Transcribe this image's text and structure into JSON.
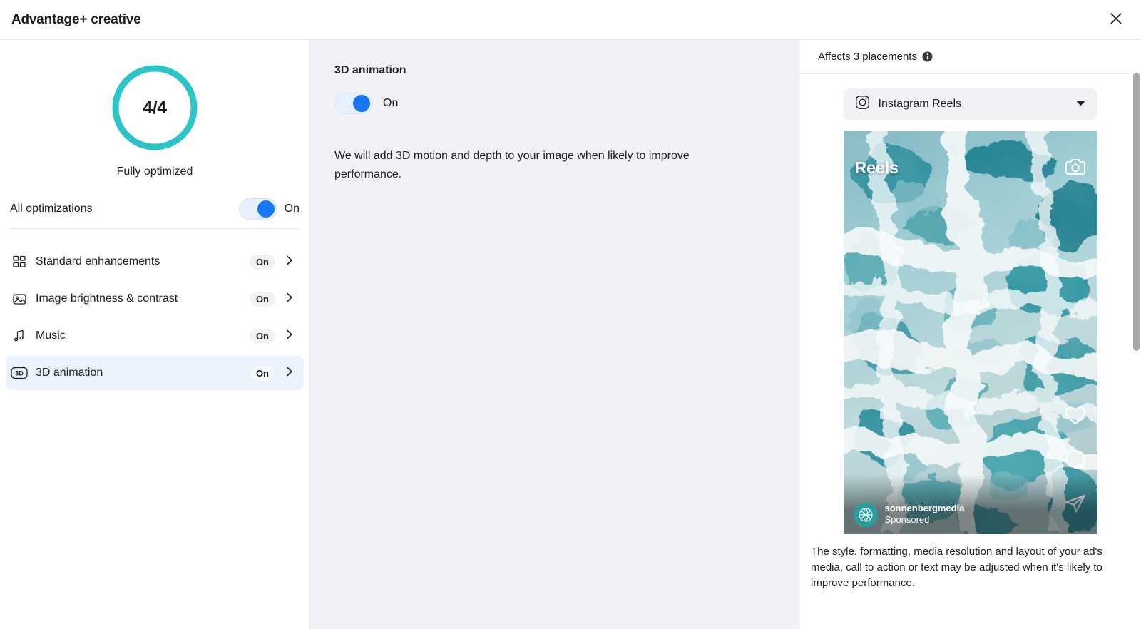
{
  "header": {
    "title": "Advantage+ creative",
    "close_icon": "close-icon"
  },
  "sidebar": {
    "gauge": {
      "value": "4/4",
      "label": "Fully optimized",
      "ring_color": "#2CC5C5",
      "completed": 4,
      "total": 4
    },
    "all_optimizations": {
      "label": "All optimizations",
      "state": "On"
    },
    "items": [
      {
        "icon": "grid-icon",
        "label": "Standard enhancements",
        "badge": "On",
        "selected": false
      },
      {
        "icon": "image-icon",
        "label": "Image brightness & contrast",
        "badge": "On",
        "selected": false
      },
      {
        "icon": "music-note-icon",
        "label": "Music",
        "badge": "On",
        "selected": false
      },
      {
        "icon": "threed-icon",
        "label": "3D animation",
        "badge": "On",
        "selected": true
      }
    ]
  },
  "main": {
    "title": "3D animation",
    "toggle_state": "On",
    "description": "We will add 3D motion and depth to your image when likely to improve performance."
  },
  "preview": {
    "affects_text": "Affects 3 placements",
    "info_icon": "info-icon",
    "placement": {
      "icon": "instagram-icon",
      "label": "Instagram Reels",
      "caret": "chevron-down-icon"
    },
    "reels": {
      "overlay_title": "Reels",
      "camera_icon": "camera-icon",
      "actions": [
        "heart-icon",
        "comment-icon",
        "share-icon"
      ],
      "account_name": "sonnenbergmedia",
      "sponsored_label": "Sponsored"
    },
    "note": "The style, formatting, media resolution and layout of your ad's media, call to action or text may be adjusted when it's likely to improve performance."
  },
  "colors": {
    "accent_blue": "#1877f2",
    "teal": "#2CC5C5",
    "panel_gray": "#f0f2f5",
    "selected_row": "#ebf2fd"
  }
}
